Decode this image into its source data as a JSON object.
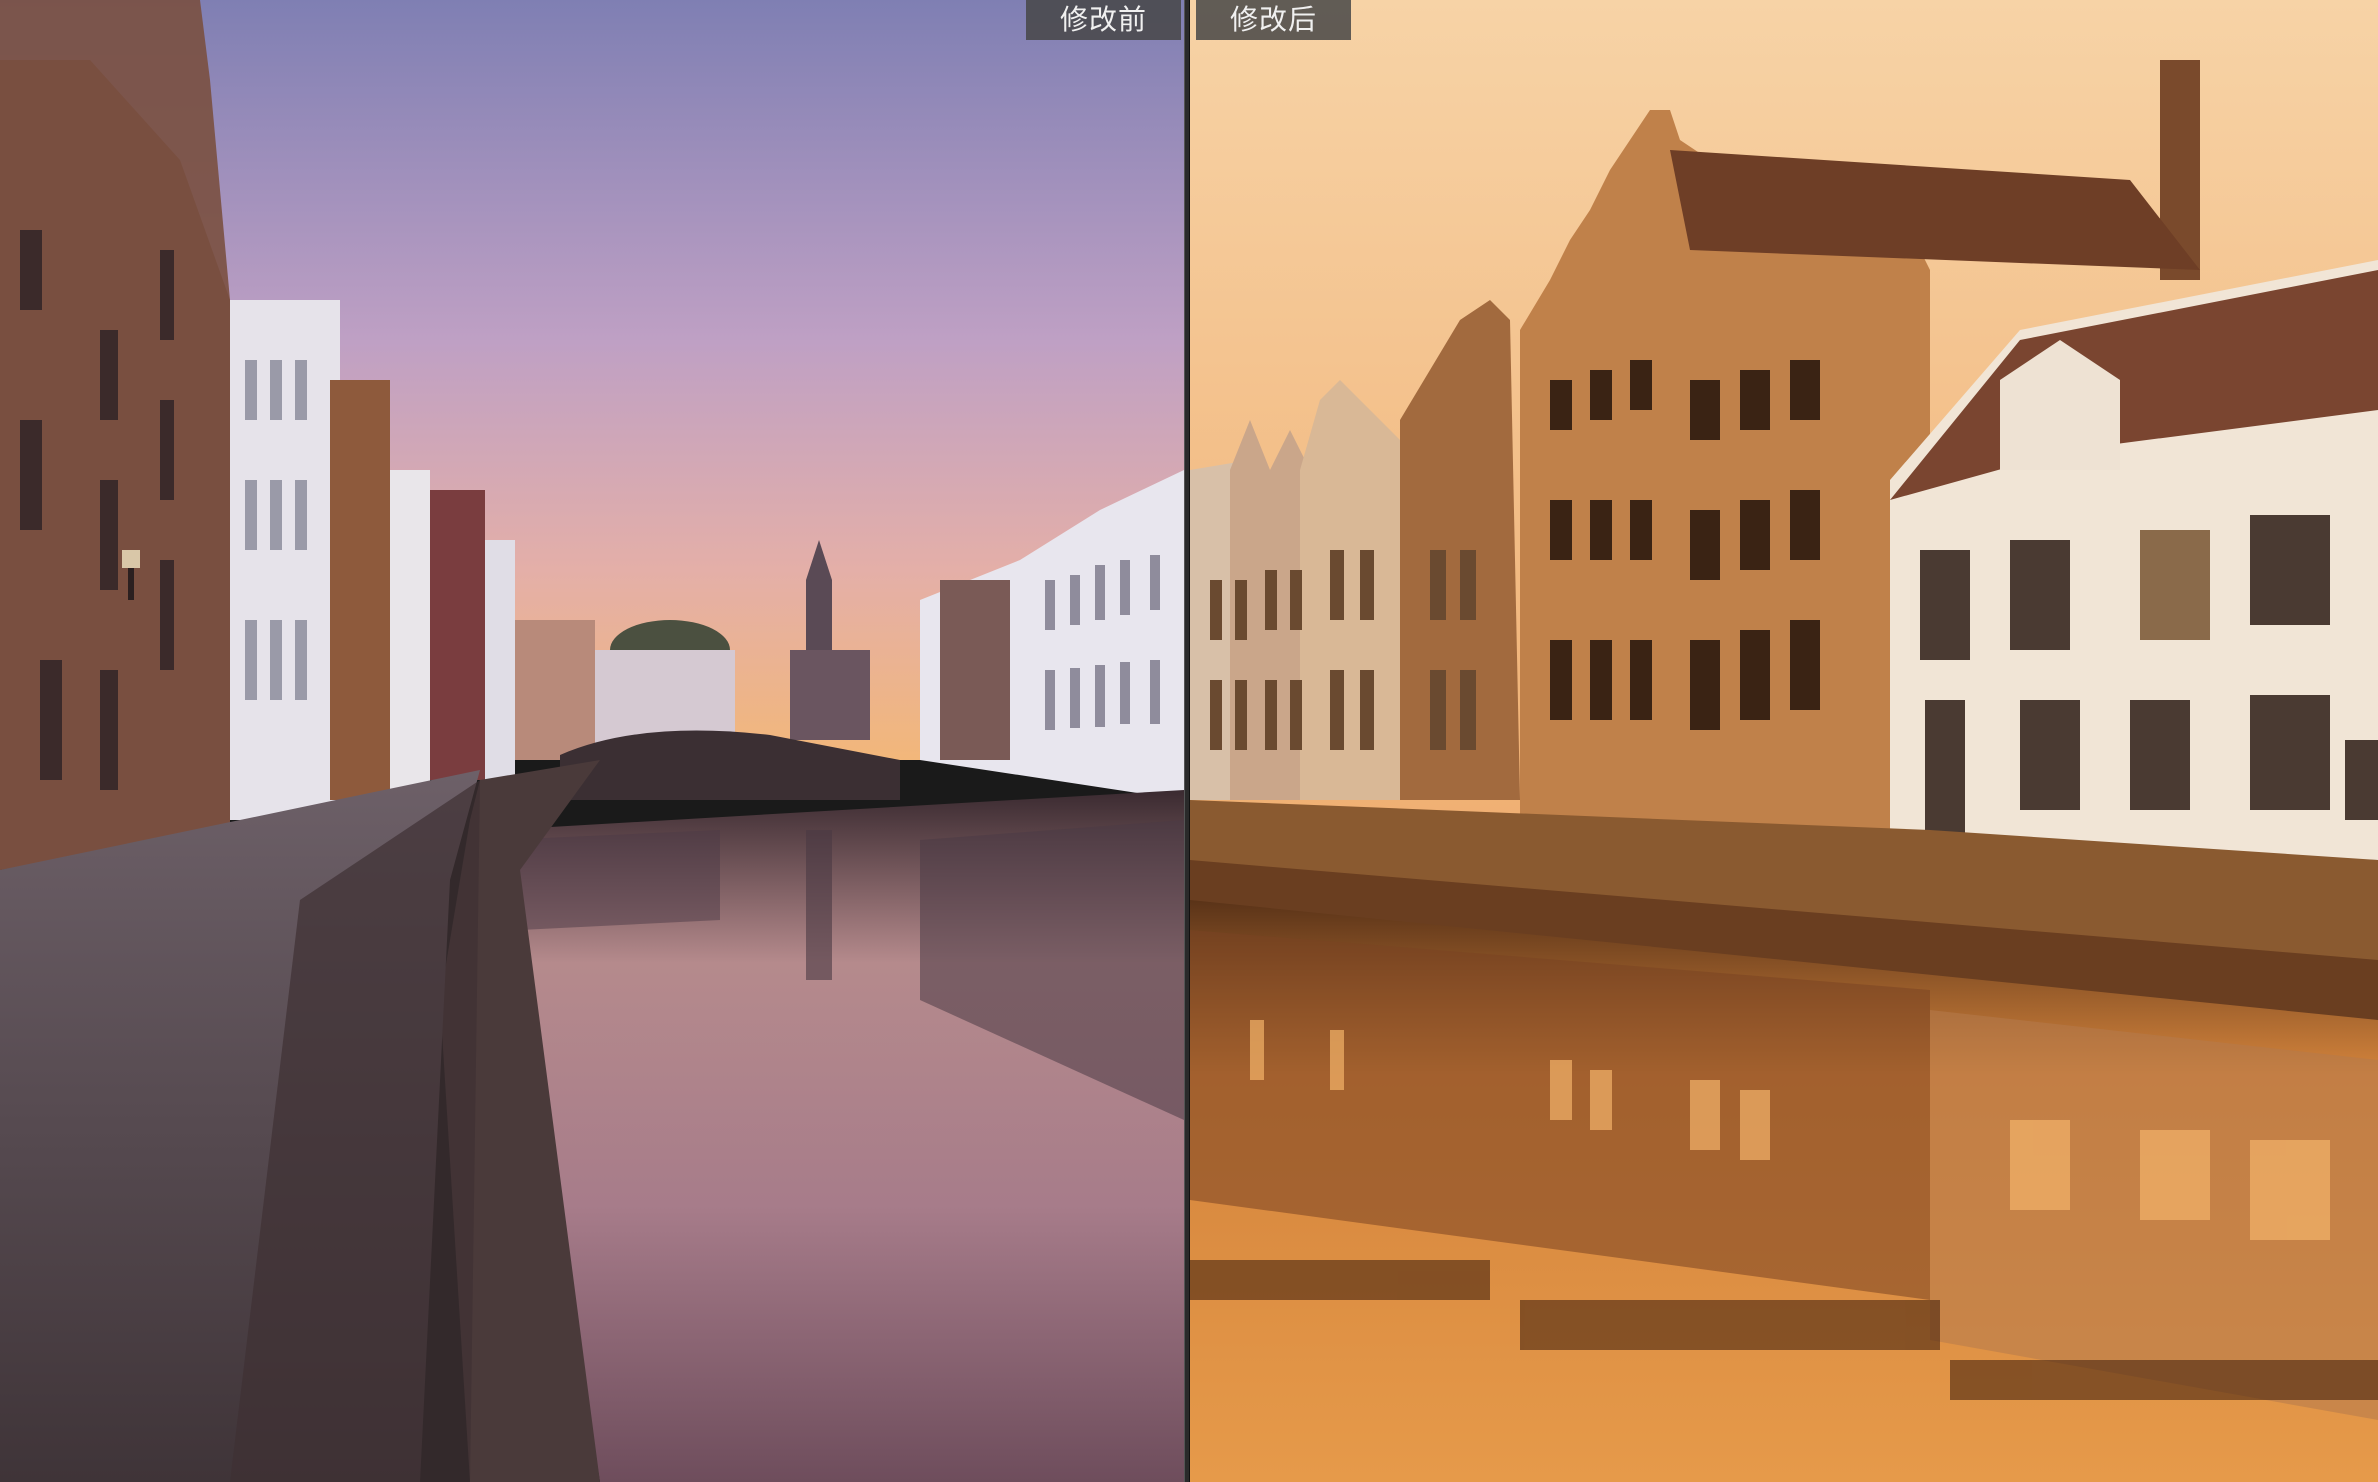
{
  "compare": {
    "before_label": "修改前",
    "after_label": "修改后"
  },
  "colors": {
    "before_sky_top": "#8a86b8",
    "before_sky_mid": "#c6a3c3",
    "before_horizon": "#f0b27a",
    "after_sky": "#f4c58c",
    "after_water": "#e79a4a",
    "divider": "#2a2a2a",
    "label_bg": "#464646"
  }
}
